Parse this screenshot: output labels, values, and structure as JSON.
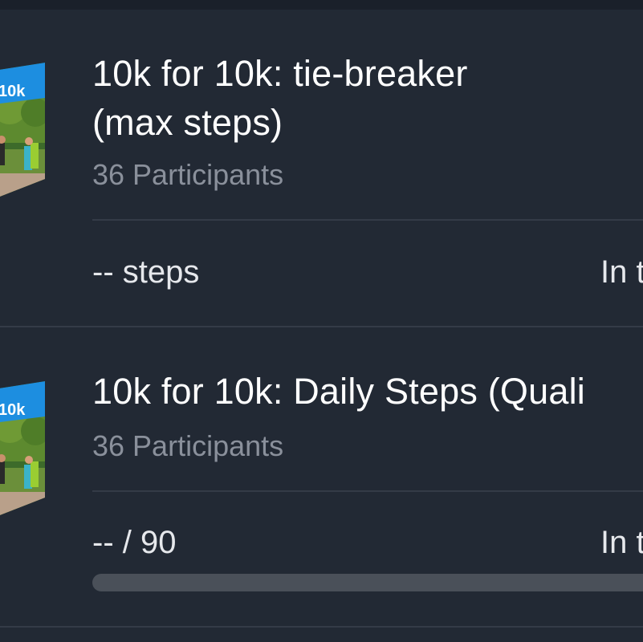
{
  "challenges": [
    {
      "title_line1": "10k for 10k: tie-breaker",
      "title_line2": "(max steps)",
      "participants": "36 Participants",
      "stat": "-- steps",
      "status": "In t",
      "thumb_badge": "10k"
    },
    {
      "title_line1": "10k for 10k: Daily Steps (Quali",
      "participants": "36 Participants",
      "stat": "-- / 90",
      "status": "In t",
      "thumb_badge": "10k",
      "progress_fraction": 0
    }
  ],
  "colors": {
    "background": "#222934",
    "divider": "#343b47",
    "secondary_text": "#8a909b",
    "progress_track": "#4a5059",
    "badge_blue": "#1d8ee0"
  }
}
